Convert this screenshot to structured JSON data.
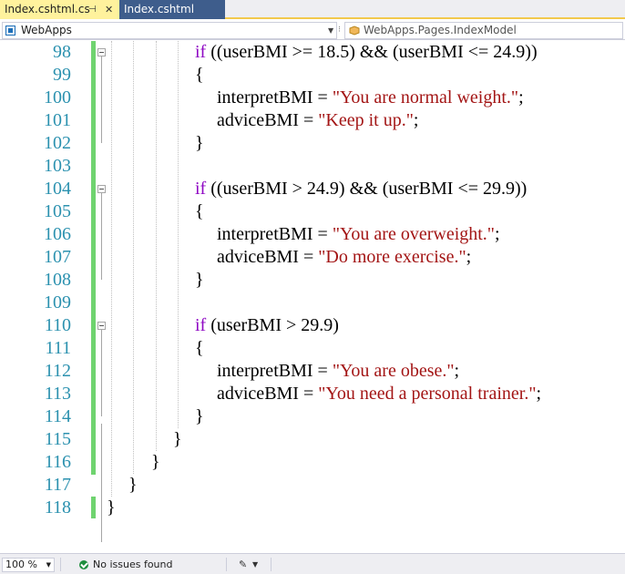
{
  "tabs": [
    {
      "label": "Index.cshtml.cs",
      "active": true
    },
    {
      "label": "Index.cshtml",
      "active": false
    }
  ],
  "tab_icons": {
    "pin": "pin-icon",
    "close": "close-icon"
  },
  "navbar": {
    "project": "WebApps",
    "class": "WebApps.Pages.IndexModel"
  },
  "code_lines": [
    {
      "num": "98",
      "tokens": [
        [
          "kw",
          "if"
        ],
        [
          "t",
          " ((userBMI >= 18.5) && (userBMI <= 24.9))"
        ]
      ],
      "indent": 4
    },
    {
      "num": "99",
      "tokens": [
        [
          "t",
          "{"
        ]
      ],
      "indent": 4
    },
    {
      "num": "100",
      "tokens": [
        [
          "t",
          "interpretBMI = "
        ],
        [
          "str",
          "\"You are normal weight.\""
        ],
        [
          "t",
          ";"
        ]
      ],
      "indent": 5
    },
    {
      "num": "101",
      "tokens": [
        [
          "t",
          "adviceBMI = "
        ],
        [
          "str",
          "\"Keep it up.\""
        ],
        [
          "t",
          ";"
        ]
      ],
      "indent": 5
    },
    {
      "num": "102",
      "tokens": [
        [
          "t",
          "}"
        ]
      ],
      "indent": 4
    },
    {
      "num": "103",
      "tokens": [],
      "indent": 0
    },
    {
      "num": "104",
      "tokens": [
        [
          "kw",
          "if"
        ],
        [
          "t",
          " ((userBMI > 24.9) && (userBMI <= 29.9))"
        ]
      ],
      "indent": 4
    },
    {
      "num": "105",
      "tokens": [
        [
          "t",
          "{"
        ]
      ],
      "indent": 4
    },
    {
      "num": "106",
      "tokens": [
        [
          "t",
          "interpretBMI = "
        ],
        [
          "str",
          "\"You are overweight.\""
        ],
        [
          "t",
          ";"
        ]
      ],
      "indent": 5
    },
    {
      "num": "107",
      "tokens": [
        [
          "t",
          "adviceBMI = "
        ],
        [
          "str",
          "\"Do more exercise.\""
        ],
        [
          "t",
          ";"
        ]
      ],
      "indent": 5
    },
    {
      "num": "108",
      "tokens": [
        [
          "t",
          "}"
        ]
      ],
      "indent": 4
    },
    {
      "num": "109",
      "tokens": [],
      "indent": 0
    },
    {
      "num": "110",
      "tokens": [
        [
          "kw",
          "if"
        ],
        [
          "t",
          " (userBMI > 29.9)"
        ]
      ],
      "indent": 4
    },
    {
      "num": "111",
      "tokens": [
        [
          "t",
          "{"
        ]
      ],
      "indent": 4
    },
    {
      "num": "112",
      "tokens": [
        [
          "t",
          "interpretBMI = "
        ],
        [
          "str",
          "\"You are obese.\""
        ],
        [
          "t",
          ";"
        ]
      ],
      "indent": 5
    },
    {
      "num": "113",
      "tokens": [
        [
          "t",
          "adviceBMI = "
        ],
        [
          "str",
          "\"You need a personal trainer.\""
        ],
        [
          "t",
          ";"
        ]
      ],
      "indent": 5
    },
    {
      "num": "114",
      "tokens": [
        [
          "t",
          "}"
        ]
      ],
      "indent": 4
    },
    {
      "num": "115",
      "tokens": [
        [
          "t",
          "}"
        ]
      ],
      "indent": 3
    },
    {
      "num": "116",
      "tokens": [
        [
          "t",
          "}"
        ]
      ],
      "indent": 2
    },
    {
      "num": "117",
      "tokens": [
        [
          "t",
          "}"
        ]
      ],
      "indent": 1
    },
    {
      "num": "118",
      "tokens": [
        [
          "t",
          "}"
        ]
      ],
      "indent": 0
    }
  ],
  "colors": {
    "keyword": "#8f08c4",
    "string": "#a31515",
    "line_number": "#2b91af",
    "change_bar": "#6fd36f",
    "active_tab": "#fff29d",
    "inactive_tab": "#3e5d8c"
  },
  "statusbar": {
    "zoom": "100 %",
    "status": "No issues found",
    "status_icon": "check-circle-icon",
    "brush_icon": "brush-icon"
  }
}
